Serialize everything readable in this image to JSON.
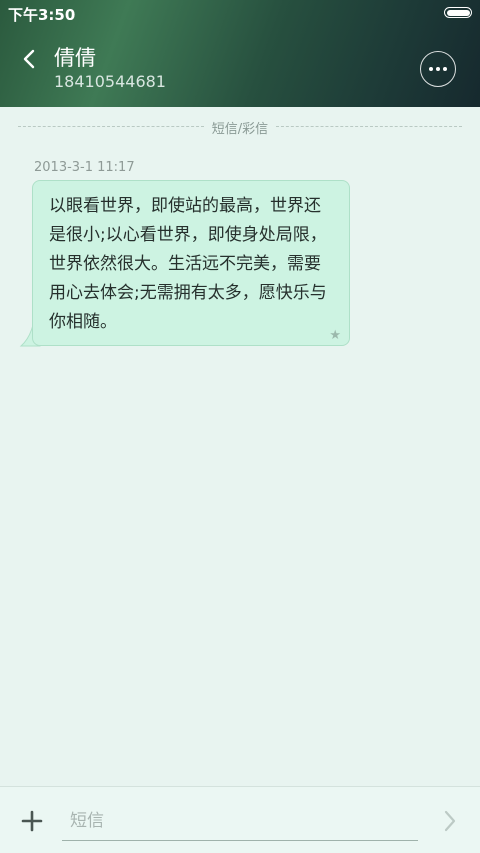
{
  "status_bar": {
    "time": "下午3:50"
  },
  "header": {
    "contact_name": "倩倩",
    "contact_number": "18410544681",
    "back_icon": "chevron-left-icon",
    "more_icon": "more-dots-icon"
  },
  "thread": {
    "divider_label": "短信/彩信",
    "messages": [
      {
        "timestamp": "2013-3-1 11:17",
        "text": "以眼看世界，即使站的最高，世界还是很小;以心看世界，即使身处局限，世界依然很大。生活远不完美，需要用心去体会;无需拥有太多，愿快乐与你相随。",
        "starred": true
      }
    ]
  },
  "composer": {
    "placeholder": "短信",
    "value": "",
    "add_icon": "plus-icon",
    "send_icon": "chevron-right-icon"
  },
  "colors": {
    "header_start": "#3f7a55",
    "header_end": "#16292e",
    "background": "#e8f4f0",
    "bubble": "#cdf3e2"
  }
}
